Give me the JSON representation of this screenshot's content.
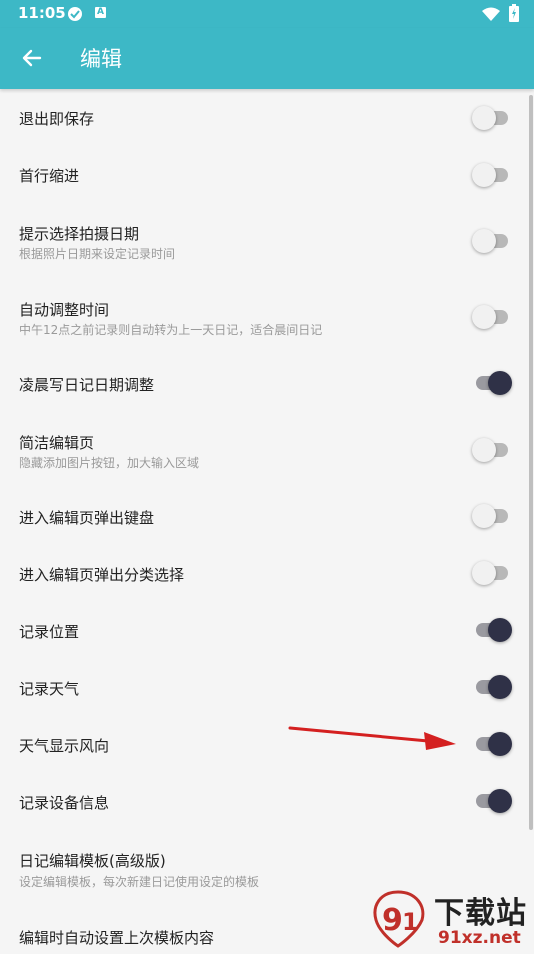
{
  "status_bar": {
    "time": "11:05",
    "icon_a": "tick-circle-icon",
    "icon_b": "A",
    "wifi": "wifi-icon",
    "battery": "battery-icon"
  },
  "app_bar": {
    "title": "编辑",
    "back_icon": "arrow-left-icon"
  },
  "settings": [
    {
      "title": "退出即保存",
      "subtitle": "",
      "on": false
    },
    {
      "title": "首行缩进",
      "subtitle": "",
      "on": false
    },
    {
      "title": "提示选择拍摄日期",
      "subtitle": "根据照片日期来设定记录时间",
      "on": false
    },
    {
      "title": "自动调整时间",
      "subtitle": "中午12点之前记录则自动转为上一天日记，适合晨间日记",
      "on": false
    },
    {
      "title": "凌晨写日记日期调整",
      "subtitle": "",
      "on": true
    },
    {
      "title": "简洁编辑页",
      "subtitle": "隐藏添加图片按钮，加大输入区域",
      "on": false
    },
    {
      "title": "进入编辑页弹出键盘",
      "subtitle": "",
      "on": false
    },
    {
      "title": "进入编辑页弹出分类选择",
      "subtitle": "",
      "on": false
    },
    {
      "title": "记录位置",
      "subtitle": "",
      "on": true
    },
    {
      "title": "记录天气",
      "subtitle": "",
      "on": true
    },
    {
      "title": "天气显示风向",
      "subtitle": "",
      "on": true
    },
    {
      "title": "记录设备信息",
      "subtitle": "",
      "on": true
    },
    {
      "title": "日记编辑模板(高级版)",
      "subtitle": "设定编辑模板，每次新建日记使用设定的模板"
    },
    {
      "title": "编辑时自动设置上次模板内容",
      "subtitle": ""
    }
  ],
  "watermark": {
    "line1": "下载站",
    "line2": "91xz.net"
  },
  "colors": {
    "accent": "#3db8c6",
    "switch_on": "#2f3147",
    "arrow": "#d42020"
  }
}
